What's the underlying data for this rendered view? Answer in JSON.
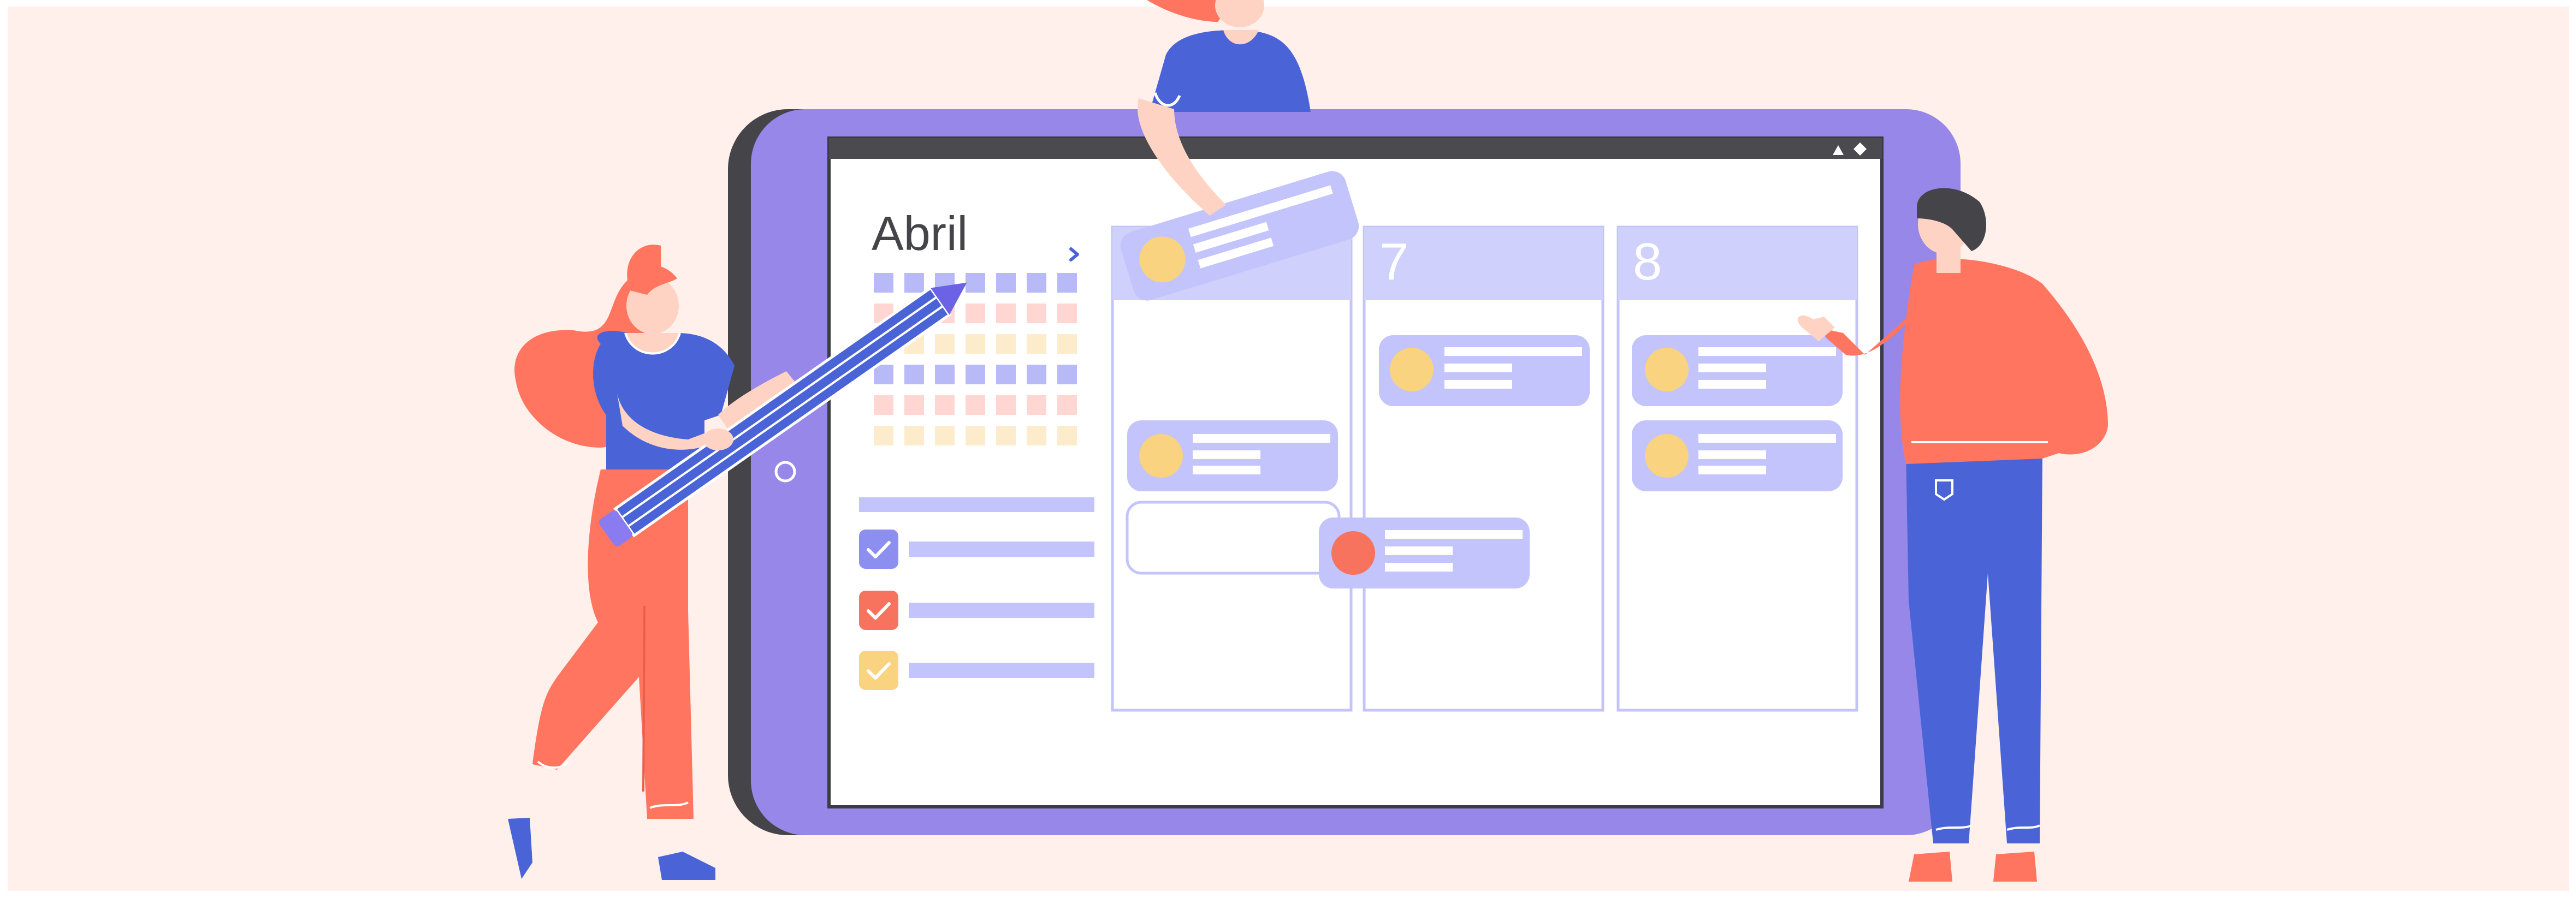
{
  "calendar": {
    "month_label": "Abril",
    "next_icon": "chevron-right-icon",
    "columns": [
      {
        "day_label": ""
      },
      {
        "day_label": "7"
      },
      {
        "day_label": "8"
      }
    ]
  },
  "tasks": [
    {
      "checked": true,
      "color": "#8c8ff0"
    },
    {
      "checked": true,
      "color": "#f7735e"
    },
    {
      "checked": true,
      "color": "#f9d37f"
    }
  ],
  "status_icons": [
    "triangle-icon",
    "diamond-icon"
  ],
  "colors": {
    "background": "#fff0ec",
    "tablet_body": "#9787e8",
    "tablet_shadow": "#454449",
    "lilac": "#c3c4fb",
    "lilac_light": "#cfd0fb",
    "accent_yellow": "#f9d37f",
    "accent_red": "#f7735e",
    "blue": "#4a64d8",
    "coral": "#ff7560"
  }
}
